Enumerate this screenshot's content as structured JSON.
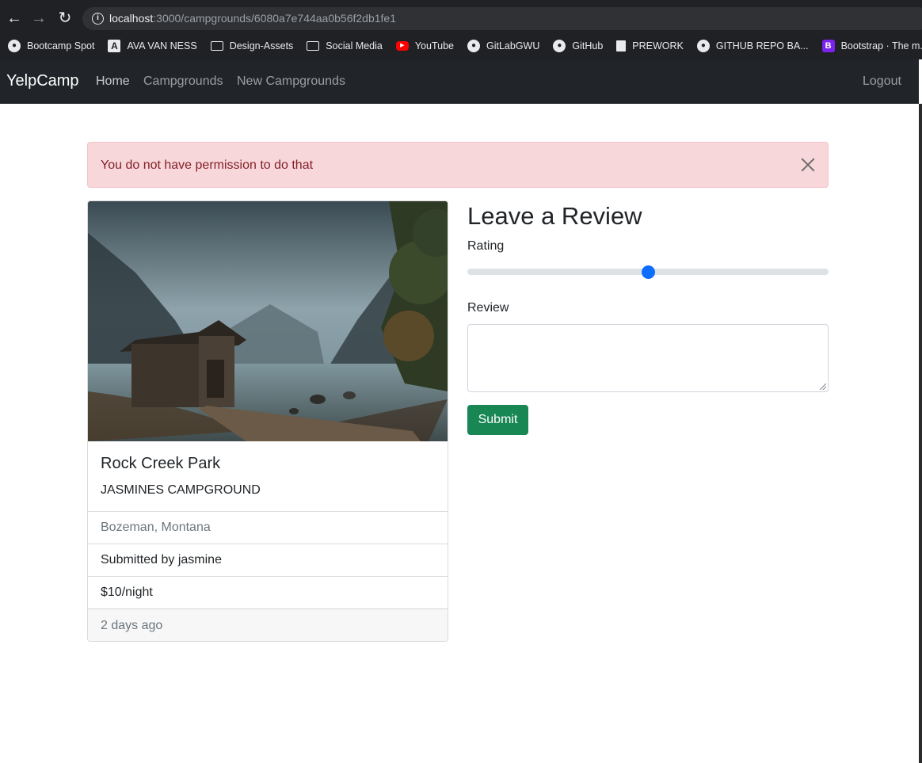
{
  "browser": {
    "url_host": "localhost",
    "url_path": ":3000/campgrounds/6080a7e744aa0b56f2db1fe1",
    "bookmarks": [
      {
        "label": "Bootcamp Spot",
        "icon": "globe-icon"
      },
      {
        "label": "AVA VAN NESS",
        "icon": "ava-logo-icon"
      },
      {
        "label": "Design-Assets",
        "icon": "folder-icon"
      },
      {
        "label": "Social Media",
        "icon": "folder-icon"
      },
      {
        "label": "YouTube",
        "icon": "youtube-icon"
      },
      {
        "label": "GitLabGWU",
        "icon": "globe-icon"
      },
      {
        "label": "GitHub",
        "icon": "github-icon"
      },
      {
        "label": "PREWORK",
        "icon": "book-icon"
      },
      {
        "label": "GITHUB REPO BA...",
        "icon": "github-icon"
      },
      {
        "label": "Bootstrap · The m...",
        "icon": "bootstrap-icon"
      }
    ]
  },
  "navbar": {
    "brand": "YelpCamp",
    "links": [
      "Home",
      "Campgrounds",
      "New Campgrounds"
    ],
    "logout": "Logout"
  },
  "alert": {
    "message": "You do not have permission to do that"
  },
  "campground": {
    "title": "Rock Creek Park",
    "description": "JASMINES CAMPGROUND",
    "location": "Bozeman, Montana",
    "submitted_by": "Submitted by jasmine",
    "price": "$10/night",
    "posted": "2 days ago"
  },
  "review_form": {
    "heading": "Leave a Review",
    "rating_label": "Rating",
    "rating_value": 0.5,
    "review_label": "Review",
    "review_value": "",
    "submit_label": "Submit"
  },
  "colors": {
    "navbar_bg": "#212529",
    "alert_bg": "#f8d7da",
    "alert_text": "#842029",
    "range_thumb": "#0d6efd",
    "submit_bg": "#198754"
  }
}
